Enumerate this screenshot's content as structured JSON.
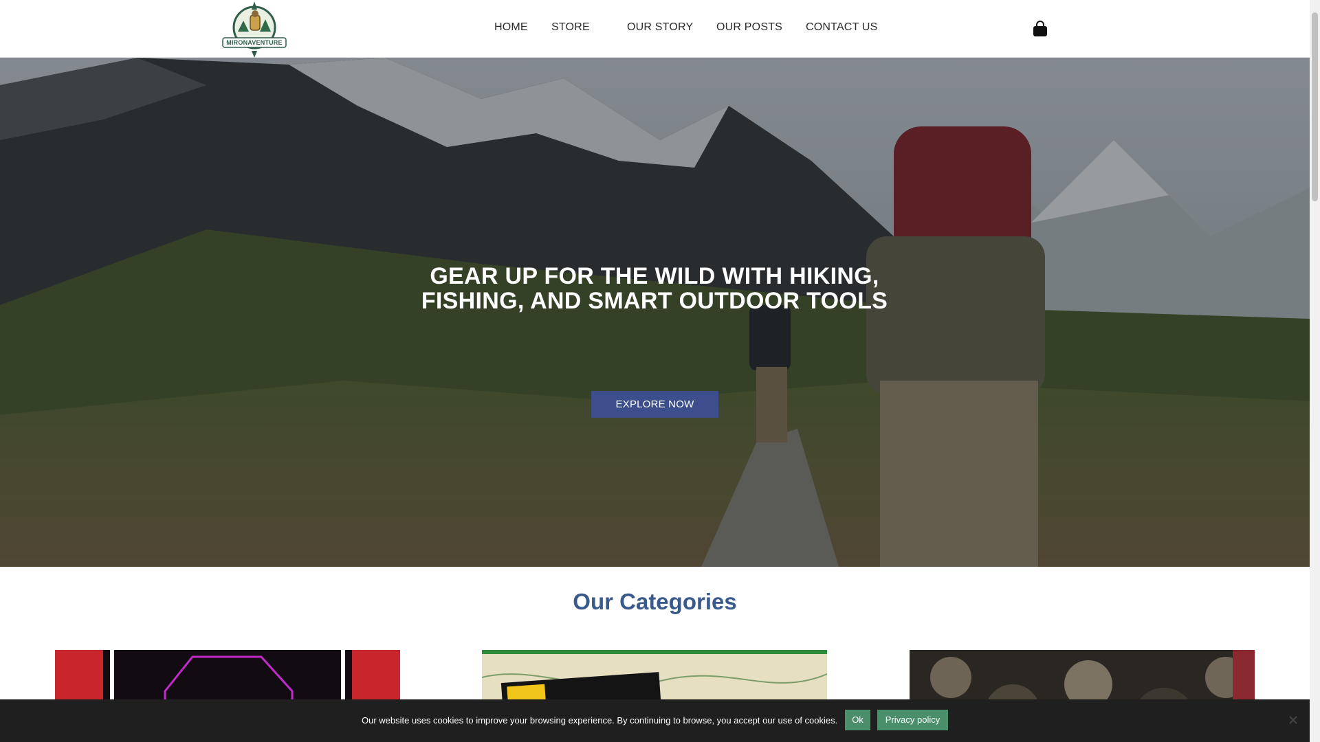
{
  "header": {
    "logo_text": "MIRONAVENTURE",
    "nav": [
      "HOME",
      "STORE",
      "OUR STORY",
      "OUR POSTS",
      "CONTACT US"
    ],
    "cart_icon": "shopping-bag-icon"
  },
  "hero": {
    "title_line1": "GEAR UP FOR THE WILD WITH HIKING,",
    "title_line2": "FISHING, AND SMART OUTDOOR TOOLS",
    "button_label": "EXPLORE NOW"
  },
  "categories": {
    "title": "Our Categories"
  },
  "cookie": {
    "message": "Our website uses cookies to improve your browsing experience. By continuing to browse, you accept our use of cookies.",
    "ok_label": "Ok",
    "privacy_label": "Privacy policy",
    "close_icon": "close-icon"
  },
  "colors": {
    "accent": "#3c4f8c",
    "heading": "#3a5a8c",
    "cookie_button": "#4a8f6a",
    "cookie_bg": "#1f1f1f"
  }
}
